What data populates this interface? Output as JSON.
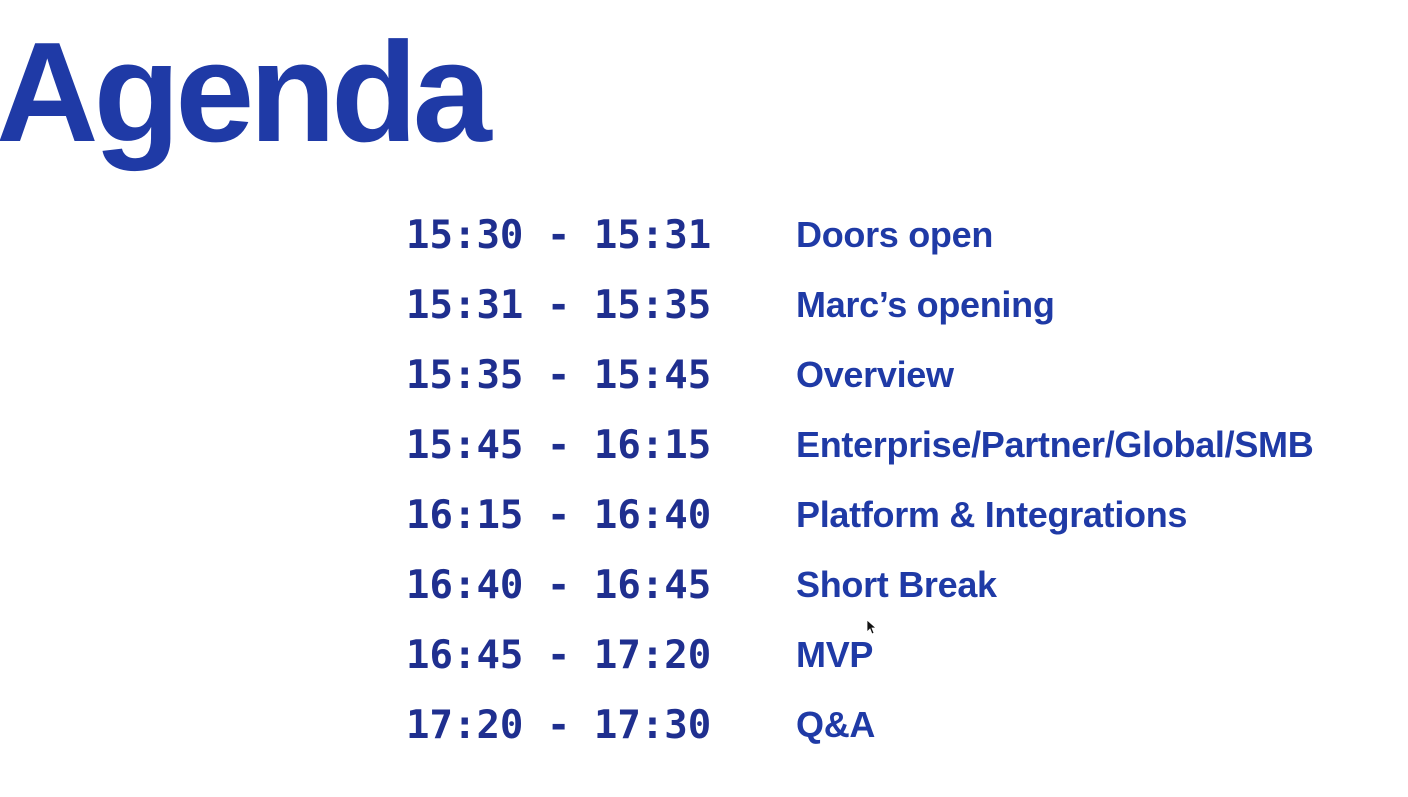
{
  "slide": {
    "title": "Agenda"
  },
  "agenda": [
    {
      "time": "15:30 - 15:31",
      "topic": "Doors open"
    },
    {
      "time": "15:31 - 15:35",
      "topic": "Marc’s opening"
    },
    {
      "time": "15:35 - 15:45",
      "topic": "Overview"
    },
    {
      "time": "15:45 - 16:15",
      "topic": "Enterprise/Partner/Global/SMB"
    },
    {
      "time": "16:15 - 16:40",
      "topic": "Platform & Integrations"
    },
    {
      "time": "16:40 - 16:45",
      "topic": "Short Break"
    },
    {
      "time": "16:45 - 17:20",
      "topic": "MVP"
    },
    {
      "time": "17:20 - 17:30",
      "topic": "Q&A"
    }
  ],
  "icons": {
    "cursor": "mouse-pointer-icon"
  },
  "colors": {
    "title": "#1f3aa6",
    "time": "#1f2f8f",
    "topic": "#1f3aa6",
    "background": "#ffffff"
  }
}
